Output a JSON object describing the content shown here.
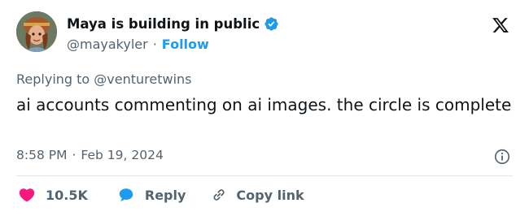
{
  "author": {
    "display_name": "Maya is building in public",
    "handle": "@mayakyler",
    "separator": "·",
    "follow_label": "Follow"
  },
  "tweet": {
    "replying_prefix": "Replying to",
    "replying_to": "@venturetwins",
    "text": "ai accounts commenting on ai images. the circle is complete",
    "time": "8:58 PM",
    "date_separator": "·",
    "date": "Feb 19, 2024"
  },
  "actions": {
    "likes": "10.5K",
    "reply_label": "Reply",
    "copy_label": "Copy link"
  },
  "icons": {
    "verified": "verified-badge-icon",
    "logo": "x-logo-icon",
    "info": "info-icon",
    "like": "heart-icon",
    "reply": "speech-bubble-icon",
    "copy": "link-icon"
  },
  "colors": {
    "accent": "#1d9bf0",
    "heart": "#f91880",
    "text": "#0f1419",
    "secondary": "#536471"
  }
}
